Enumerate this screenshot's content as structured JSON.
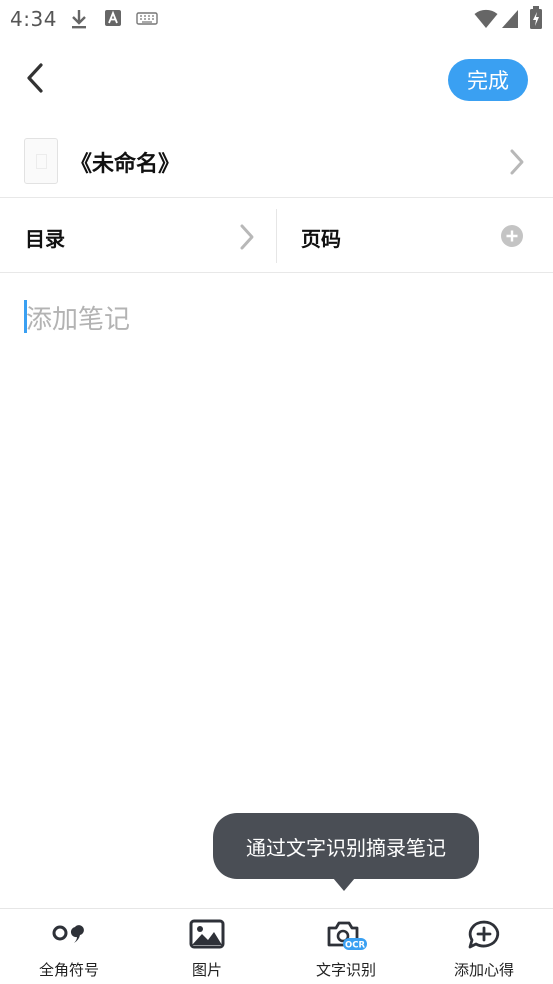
{
  "status_bar": {
    "time": "4:34",
    "icons": [
      "download-icon",
      "a-badge-icon",
      "keyboard-icon",
      "wifi-icon",
      "signal-icon",
      "battery-icon"
    ]
  },
  "top_bar": {
    "back_icon": "chevron-left-icon",
    "done_label": "完成",
    "done_color": "#3aa0f2"
  },
  "book": {
    "title": "《未命名》"
  },
  "meta": {
    "catalog_label": "目录",
    "page_label": "页码"
  },
  "note": {
    "placeholder": "添加笔记",
    "caret_color": "#3aa0f2"
  },
  "tooltip": {
    "text": "通过文字识别摘录笔记"
  },
  "toolbar": {
    "items": [
      {
        "label": "全角符号",
        "icon": "punctuation-icon"
      },
      {
        "label": "图片",
        "icon": "image-icon"
      },
      {
        "label": "文字识别",
        "icon": "ocr-camera-icon",
        "badge": "OCR"
      },
      {
        "label": "添加心得",
        "icon": "add-comment-icon"
      }
    ]
  }
}
